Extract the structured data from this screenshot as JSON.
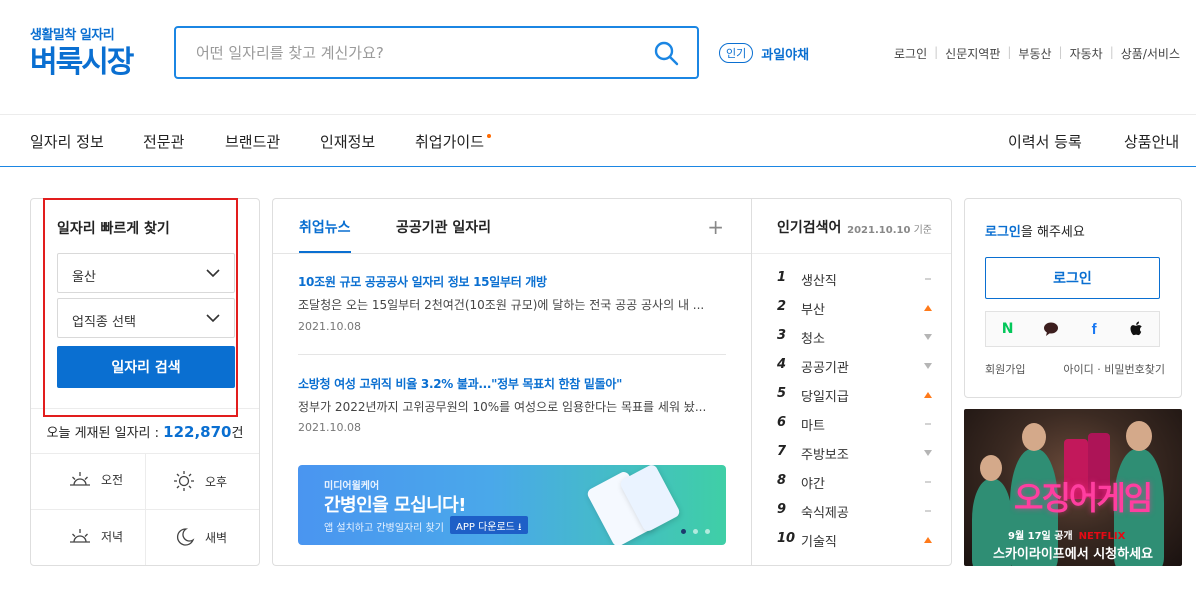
{
  "header": {
    "logo_sub": "생활밀착 일자리",
    "logo_main": "벼룩시장",
    "search_placeholder": "어떤 일자리를 찾고 계신가요?",
    "popular_badge": "인기",
    "popular_keyword": "과일야채",
    "util_links": [
      "로그인",
      "신문지역판",
      "부동산",
      "자동차",
      "상품/서비스"
    ]
  },
  "gnb": {
    "left": [
      "일자리 정보",
      "전문관",
      "브랜드관",
      "인재정보",
      "취업가이드"
    ],
    "right": [
      "이력서 등록",
      "상품안내"
    ]
  },
  "quick": {
    "title": "일자리 빠르게 찾기",
    "region": "울산",
    "job_type": "업직종 선택",
    "search_button": "일자리 검색",
    "count_prefix": "오늘 게재된 일자리 : ",
    "count_value": "122,870",
    "count_suffix": "건",
    "times": [
      "오전",
      "오후",
      "저녁",
      "새벽"
    ]
  },
  "news": {
    "tabs": [
      "취업뉴스",
      "공공기관 일자리"
    ],
    "plus": "+",
    "articles": [
      {
        "headline": "10조원 규모 공공공사 일자리 정보 15일부터 개방",
        "body": "조달청은 오는 15일부터 2천여건(10조원 규모)에 달하는 전국 공공 공사의 내 ...",
        "date": "2021.10.08"
      },
      {
        "headline": "소방청 여성 고위직 비율 3.2% 불과...\"정부 목표치 한참 밑돌아\"",
        "body": "정부가 2022년까지 고위공무원의 10%를 여성으로 임용한다는 목표를 세워 놨...",
        "date": "2021.10.08"
      }
    ],
    "banner": {
      "small": "미디어윌케어",
      "title": "간병인을 모십니다!",
      "desc": "앱 설치하고 간병일자리 찾기",
      "app_button": "APP 다운로드 ⭳"
    }
  },
  "ranking": {
    "title": "인기검색어",
    "date": "2021.10.10",
    "date_suffix": "기준",
    "items": [
      {
        "rank": "1",
        "word": "생산직",
        "status": "same"
      },
      {
        "rank": "2",
        "word": "부산",
        "status": "up"
      },
      {
        "rank": "3",
        "word": "청소",
        "status": "down"
      },
      {
        "rank": "4",
        "word": "공공기관",
        "status": "down"
      },
      {
        "rank": "5",
        "word": "당일지급",
        "status": "up"
      },
      {
        "rank": "6",
        "word": "마트",
        "status": "same"
      },
      {
        "rank": "7",
        "word": "주방보조",
        "status": "down"
      },
      {
        "rank": "8",
        "word": "야간",
        "status": "same"
      },
      {
        "rank": "9",
        "word": "숙식제공",
        "status": "same"
      },
      {
        "rank": "10",
        "word": "기술직",
        "status": "up"
      }
    ],
    "colors": {
      "up": "#ff7a1a",
      "down": "#b5b5b5",
      "same": "#b5b5b5"
    }
  },
  "login": {
    "msg_bold": "로그인",
    "msg_rest": "을 해주세요",
    "button": "로그인",
    "social": [
      "naver-icon",
      "kakao-icon",
      "facebook-icon",
      "apple-icon"
    ],
    "join": "회원가입",
    "find": "아이디 · 비밀번호찾기"
  },
  "ad": {
    "title": "오징어게임",
    "date": "9월 17일 공개",
    "netflix": "NETFLIX",
    "caption": "스카이라이프에서 시청하세요"
  },
  "colors": {
    "brand": "#0a6fd1",
    "accent": "#ff6a00",
    "highlight": "#e21d1d"
  }
}
